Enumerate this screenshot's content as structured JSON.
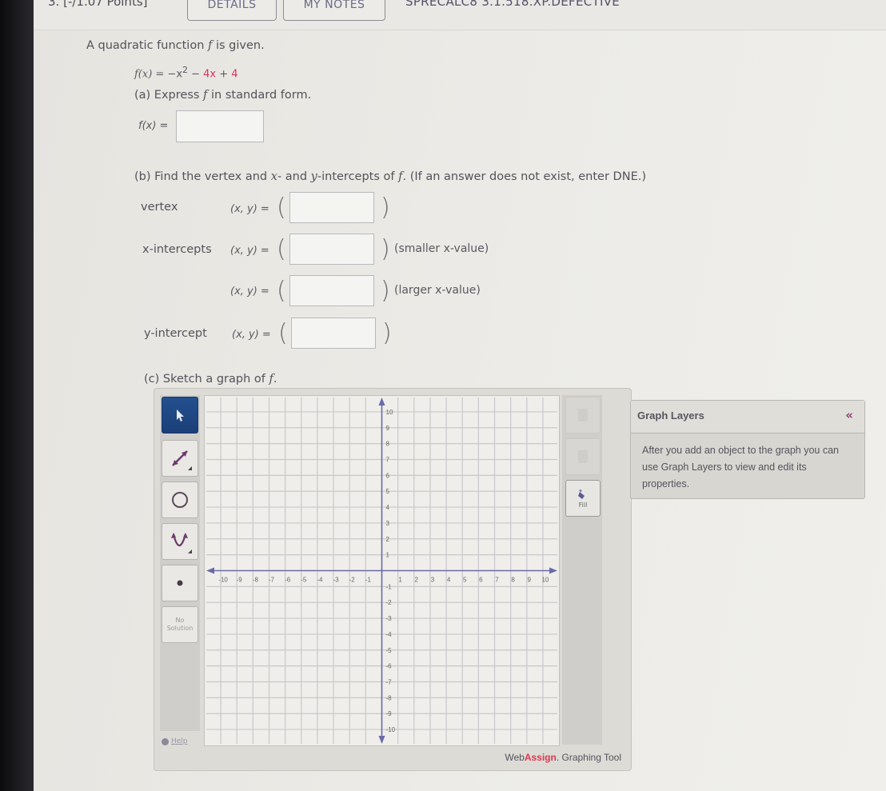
{
  "header": {
    "question_number": "3.",
    "points": "[-/1.07 Points]",
    "details_button": "DETAILS",
    "notes_button": "MY NOTES",
    "problem_code": "SPRECALC8 3.1.518.XP.DEFECTIVE"
  },
  "intro": {
    "text_before": "A quadratic function ",
    "text_var": "f",
    "text_after": " is given.",
    "func_lhs": "f(x) = ",
    "func_t1": "−x",
    "func_exp": "2",
    "func_op1": " − ",
    "func_t2": "4x",
    "func_op2": " + ",
    "func_t3": "4"
  },
  "part_a": {
    "prompt_before": "(a) Express ",
    "prompt_var": "f",
    "prompt_after": " in standard form.",
    "label": "f(x) =",
    "value": ""
  },
  "part_b": {
    "prompt_before": "(b) Find the vertex and ",
    "prompt_x": "x",
    "prompt_mid": "- and ",
    "prompt_y": "y",
    "prompt_mid2": "-intercepts of ",
    "prompt_f": "f",
    "prompt_after": ". (If an answer does not exist, enter DNE.)",
    "rows": [
      {
        "label": "vertex",
        "eq": "(x, y) =",
        "value": "",
        "note": ""
      },
      {
        "label": "x-intercepts",
        "eq": "(x, y) =",
        "value": "",
        "note": "(smaller x-value)"
      },
      {
        "label": "",
        "eq": "(x, y) =",
        "value": "",
        "note": "(larger x-value)"
      },
      {
        "label": "y-intercept",
        "eq": "(x, y) =",
        "value": "",
        "note": ""
      }
    ]
  },
  "part_c": {
    "prompt_before": "(c) Sketch a graph of ",
    "prompt_var": "f",
    "prompt_after": "."
  },
  "graph_tool": {
    "tools": [
      {
        "name": "select-tool",
        "active": true
      },
      {
        "name": "line-tool",
        "active": false
      },
      {
        "name": "circle-tool",
        "active": false
      },
      {
        "name": "parabola-tool",
        "active": false
      },
      {
        "name": "point-tool",
        "active": false
      }
    ],
    "no_solution_line1": "No",
    "no_solution_line2": "Solution",
    "help": "Help",
    "fill_label": "Fill",
    "x_ticks": [
      "-10",
      "-9",
      "-8",
      "-7",
      "-6",
      "-5",
      "-4",
      "-3",
      "-2",
      "-1",
      "1",
      "2",
      "3",
      "4",
      "5",
      "6",
      "7",
      "8",
      "9",
      "10"
    ],
    "y_ticks": [
      "10",
      "9",
      "8",
      "7",
      "6",
      "5",
      "4",
      "3",
      "2",
      "1",
      "-1",
      "-2",
      "-3",
      "-4",
      "-5",
      "-6",
      "-7",
      "-8",
      "-9",
      "-10"
    ],
    "x_range": [
      -10,
      10
    ],
    "y_range": [
      -10,
      10
    ],
    "footer_web": "Web",
    "footer_assign": "Assign",
    "footer_rest": ". Graphing Tool",
    "colors": {
      "accent": "#1b3f78",
      "brand_red": "#e0364f",
      "axis": "#6a6aa8"
    }
  },
  "layers_panel": {
    "title": "Graph Layers",
    "collapse_glyph": "«",
    "body": "After you add an object to the graph you can use Graph Layers to view and edit its properties."
  }
}
